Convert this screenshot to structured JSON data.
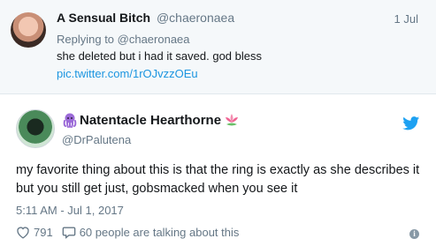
{
  "reply_tweet": {
    "display_name": "A Sensual Bitch",
    "handle": "@chaeronaea",
    "date": "1 Jul",
    "replying_to": "Replying to @chaeronaea",
    "text": "she deleted but i had it saved. god bless",
    "link": "pic.twitter.com/1rOJvzzOEu"
  },
  "main_tweet": {
    "display_name": "Natentacle Hearthorne",
    "handle": "@DrPalutena",
    "text": "my favorite thing about this is that the ring is exactly as she describes it but you still get just, gobsmacked when you see it",
    "timestamp": "5:11 AM - Jul 1, 2017",
    "likes": "791",
    "conversation": "60 people are talking about this",
    "accent_color": "#1da1f2",
    "emoji_left": "octopus-icon",
    "emoji_right": "lotus-icon"
  }
}
